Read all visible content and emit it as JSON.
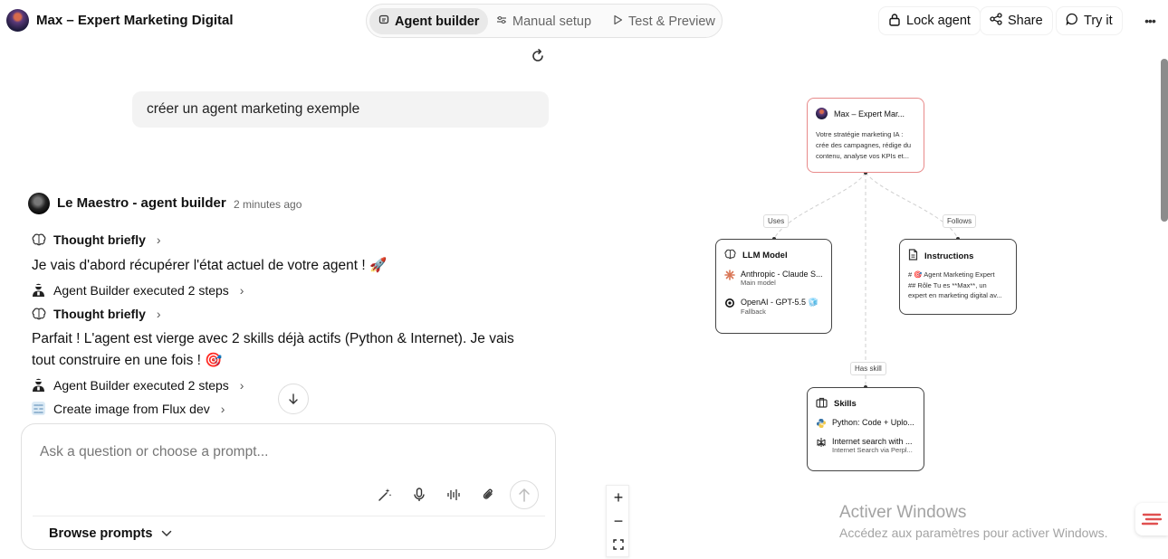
{
  "header": {
    "title": "Max – Expert Marketing Digital",
    "tabs": [
      {
        "label": "Agent builder",
        "icon": "chat-bubble-icon"
      },
      {
        "label": "Manual setup",
        "icon": "sliders-icon"
      },
      {
        "label": "Test & Preview",
        "icon": "play-icon"
      }
    ],
    "actions": {
      "lock": "Lock agent",
      "share": "Share",
      "try": "Try it",
      "more": "•••"
    }
  },
  "chat": {
    "user_message": "créer un agent marketing exemple",
    "bot_name": "Le Maestro - agent builder",
    "bot_time": "2 minutes ago",
    "steps": [
      {
        "label": "Thought briefly",
        "icon": "brain-icon"
      },
      {
        "label": "Agent Builder executed 2 steps",
        "icon": "agent-icon"
      },
      {
        "label": "Thought briefly",
        "icon": "brain-icon"
      },
      {
        "label": "Agent Builder executed 2 steps",
        "icon": "agent-icon"
      },
      {
        "label": "Create image from Flux dev",
        "icon": "flux-icon"
      }
    ],
    "messages": [
      "Je vais d'abord récupérer l'état actuel de votre agent ! 🚀",
      "Parfait ! L'agent est vierge avec 2 skills déjà actifs (Python & Internet). Je vais tout construire en une fois ! 🎯"
    ]
  },
  "composer": {
    "placeholder": "Ask a question or choose a prompt...",
    "browse_label": "Browse prompts"
  },
  "graph": {
    "root": {
      "title": "Max – Expert Mar...",
      "description_lines": [
        "Votre stratégie marketing IA :",
        "crée des campagnes, rédige du",
        "contenu, analyse vos KPIs et..."
      ]
    },
    "edges": {
      "uses": "Uses",
      "follows": "Follows",
      "has_skill": "Has skill"
    },
    "llm": {
      "title": "LLM Model",
      "models": [
        {
          "name": "Anthropic - Claude S...",
          "sub": "Main model"
        },
        {
          "name": "OpenAI - GPT-5.5 🧊",
          "sub": "Fallback"
        }
      ]
    },
    "instructions": {
      "title": "Instructions",
      "lines": [
        "# 🎯 Agent Marketing Expert",
        "## Rôle Tu es **Max**, un",
        "expert en marketing digital av..."
      ]
    },
    "skills": {
      "title": "Skills",
      "items": [
        {
          "name": "Python: Code + Uplo...",
          "sub": ""
        },
        {
          "name": "Internet search with ...",
          "sub": "Internet Search via Perpl..."
        }
      ]
    }
  },
  "zoom": {
    "plus": "+",
    "minus": "−"
  },
  "watermark": {
    "title": "Activer Windows",
    "subtitle": "Accédez aux paramètres pour activer Windows."
  },
  "colors": {
    "root_border": "#e88a8a",
    "node_border": "#444444",
    "accent_red": "#e05050"
  }
}
